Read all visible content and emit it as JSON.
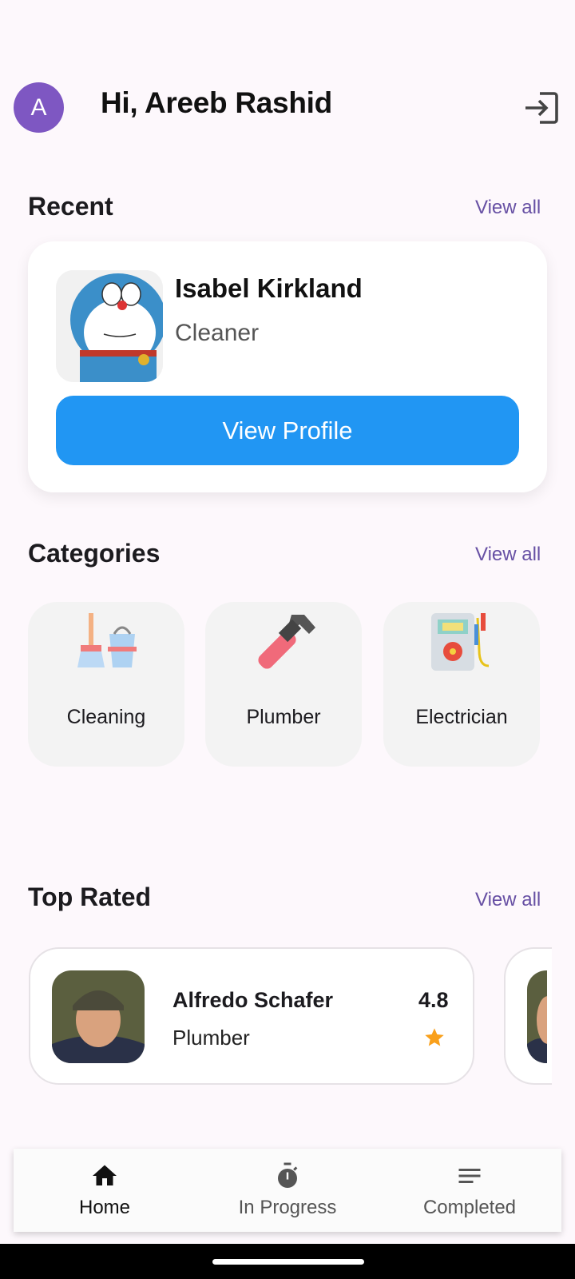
{
  "header": {
    "avatar_initial": "A",
    "greeting": "Hi, Areeb Rashid",
    "logout_icon": "logout-icon"
  },
  "recent": {
    "title": "Recent",
    "view_all": "View all",
    "card": {
      "name": "Isabel Kirkland",
      "role": "Cleaner",
      "button": "View Profile"
    }
  },
  "categories": {
    "title": "Categories",
    "view_all": "View all",
    "items": [
      {
        "label": "Cleaning",
        "icon": "broom-bucket-icon"
      },
      {
        "label": "Plumber",
        "icon": "pipe-wrench-icon"
      },
      {
        "label": "Electrician",
        "icon": "multimeter-icon"
      }
    ]
  },
  "top_rated": {
    "title": "Top Rated",
    "view_all": "View all",
    "items": [
      {
        "name": "Alfredo Schafer",
        "role": "Plumber",
        "rating": "4.8"
      }
    ]
  },
  "bottom_nav": {
    "items": [
      {
        "label": "Home",
        "icon": "home-icon",
        "active": true
      },
      {
        "label": "In Progress",
        "icon": "timer-icon",
        "active": false
      },
      {
        "label": "Completed",
        "icon": "list-lines-icon",
        "active": false
      }
    ]
  },
  "colors": {
    "background": "#fdf8fc",
    "accent_purple": "#6750a4",
    "avatar": "#7e57c2",
    "primary_button": "#2196f3",
    "star": "#f9a01b"
  }
}
